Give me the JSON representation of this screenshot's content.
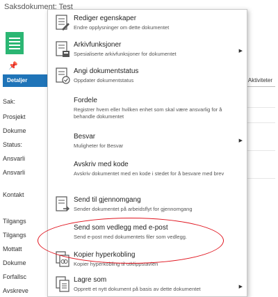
{
  "page": {
    "title": "Saksdokument: Test",
    "active_tab": "Detaljer",
    "right_tab": "Aktiviteter",
    "field_labels": [
      "Sak:",
      "Prosjekt",
      "Dokume",
      "Status:",
      "Ansvarli",
      "Ansvarli",
      "Kontakt",
      "Tilgangs",
      "Tilgangs",
      "Mottatt",
      "Dokume",
      "Forfallsc",
      "Avskreve"
    ]
  },
  "menu": {
    "items": [
      {
        "label": "Rediger egenskaper",
        "desc": "Endre opplysninger om dette dokumentet",
        "icon": "edit-properties-icon",
        "submenu": false
      },
      {
        "label": "Arkivfunksjoner",
        "desc": "Spesialiserte arkivfunksjoner for dokumentet",
        "icon": "archive-functions-icon",
        "submenu": true
      },
      {
        "label": "Angi dokumentstatus",
        "desc": "Oppdater dokumentstatus",
        "icon": "document-status-icon",
        "submenu": false
      },
      {
        "label": "Fordele",
        "desc": "Registrer hvem eller hvilken enhet som skal være ansvarlig for å behandle dokumentet",
        "icon": "",
        "submenu": false
      },
      {
        "label": "Besvar",
        "desc": "Muligheter for Besvar",
        "icon": "",
        "submenu": true
      },
      {
        "label": "Avskriv med kode",
        "desc": "Avskriv dokumentet med en kode i stedet for å besvare med brev",
        "icon": "",
        "submenu": false
      },
      {
        "label": "Send til gjennomgang",
        "desc": "Sender dokumentet på arbeidsflyt for gjennomgang",
        "icon": "send-review-icon",
        "submenu": false
      },
      {
        "label": "Send som vedlegg med e-post",
        "desc": "Send e-post med dokumentets filer som vedlegg.",
        "icon": "",
        "submenu": false
      },
      {
        "label": "Kopier hyperkobling",
        "desc": "Kopier hyperkobling til utklippstavlen",
        "icon": "copy-hyperlink-icon",
        "submenu": false
      },
      {
        "label": "Lagre som",
        "desc": "Opprett et nytt dokument på basis av dette dokumentet",
        "icon": "save-as-icon",
        "submenu": true
      }
    ]
  },
  "highlight_color": "#e0141e",
  "accent_color": "#1f74b8"
}
